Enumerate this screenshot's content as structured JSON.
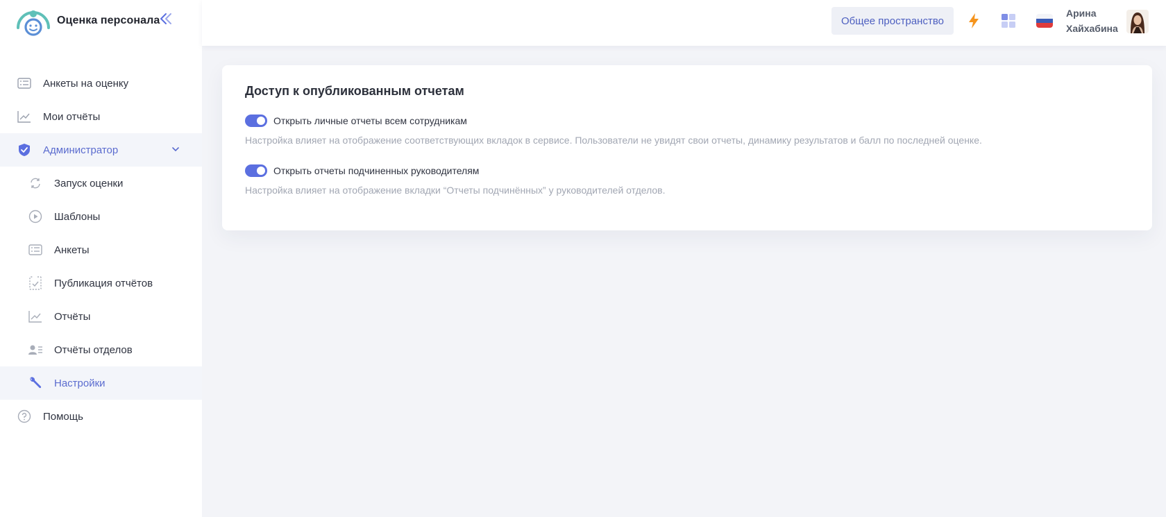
{
  "app": {
    "title": "Оценка персонала"
  },
  "sidebar": {
    "items": [
      {
        "label": "Анкеты на оценку",
        "icon": "form-list-icon"
      },
      {
        "label": "Мои отчёты",
        "icon": "chart-line-icon"
      }
    ],
    "admin": {
      "label": "Администратор",
      "icon": "shield-icon",
      "expanded": true,
      "children": [
        {
          "label": "Запуск оценки",
          "icon": "refresh-icon"
        },
        {
          "label": "Шаблоны",
          "icon": "play-circle-icon"
        },
        {
          "label": "Анкеты",
          "icon": "form-list-icon"
        },
        {
          "label": "Публикация отчётов",
          "icon": "checklist-icon"
        },
        {
          "label": "Отчёты",
          "icon": "chart-line-icon"
        },
        {
          "label": "Отчёты отделов",
          "icon": "users-list-icon"
        },
        {
          "label": "Настройки",
          "icon": "wrench-icon",
          "active": true
        }
      ]
    },
    "help": {
      "label": "Помощь",
      "icon": "question-circle-icon"
    }
  },
  "header": {
    "space_button": "Общее пространство",
    "user": {
      "first_name": "Арина",
      "last_name": "Хайхабина"
    }
  },
  "colors": {
    "accent": "#5b6fe0",
    "active_text": "#5b6ccf",
    "lightning": "#f5941d"
  },
  "settings": {
    "title": "Доступ к опубликованным отчетам",
    "options": [
      {
        "label": "Открыть личные отчеты всем сотрудникам",
        "enabled": true,
        "description": "Настройка влияет на отображение соответствующих вкладок в сервисе. Пользователи не увидят свои отчеты, динамику результатов и балл по последней оценке."
      },
      {
        "label": "Открыть отчеты подчиненных руководителям",
        "enabled": true,
        "description": "Настройка влияет на отображение вкладки “Отчеты подчинённых” у руководителей отделов."
      }
    ]
  }
}
